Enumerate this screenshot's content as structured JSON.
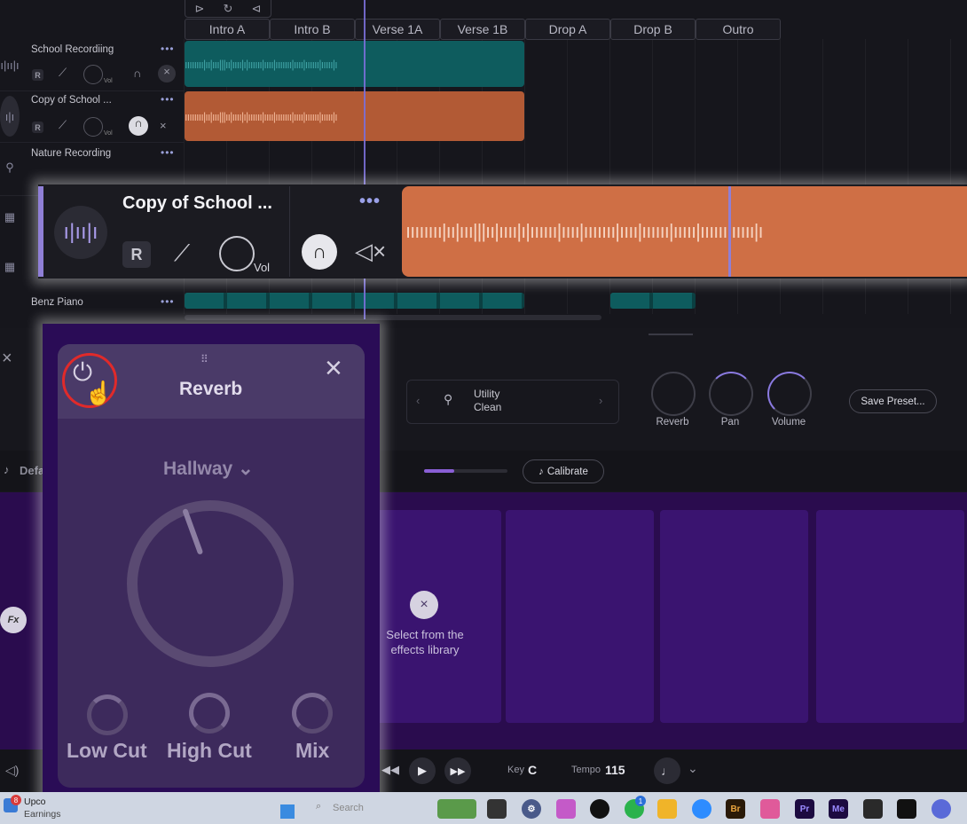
{
  "timeline": {
    "sections": [
      "Intro A",
      "Intro B",
      "Verse 1A",
      "Verse 1B",
      "Drop A",
      "Drop B",
      "Outro"
    ],
    "tracks": [
      {
        "name": "School Recordiing",
        "color": "#0e5c5e"
      },
      {
        "name": "Copy of School ...",
        "color": "#b25a35"
      },
      {
        "name": "Nature Recording",
        "color": ""
      },
      {
        "name": "Benz Piano",
        "color": "#0e5c5e"
      }
    ],
    "r_label": "R",
    "vol_label": "Vol",
    "dots": "•••"
  },
  "highlight_track": {
    "title": "Copy of School ...",
    "r_label": "R",
    "vol_label": "Vol",
    "dots": "•••",
    "clip_color": "#cf6f45",
    "accent_color": "#8f7fd6"
  },
  "panel": {
    "preset_name": "Utility",
    "preset_sub": "Clean",
    "knobs": [
      "Reverb",
      "Pan",
      "Volume"
    ],
    "save_preset": "Save Preset...",
    "calibrate": "Calibrate",
    "input_label_partial": "Defa",
    "fx_label": "Fx",
    "empty_hint_line1": "Select from the",
    "empty_hint_line2": "effects library"
  },
  "transport": {
    "key_label": "Key",
    "key_value": "C",
    "tempo_label": "Tempo",
    "tempo_value": "115"
  },
  "reverb_popup": {
    "title": "Reverb",
    "preset": "Hallway",
    "knobs": [
      "Low Cut",
      "High Cut",
      "Mix"
    ],
    "power_ring_color": "#e02a2a"
  },
  "taskbar": {
    "news_line1": "Upco",
    "news_line2": "Earnings",
    "news_badge": "8",
    "search_placeholder": "Search",
    "whatsapp_badge": "1",
    "apps": [
      "Br",
      "Pr",
      "Me"
    ]
  }
}
